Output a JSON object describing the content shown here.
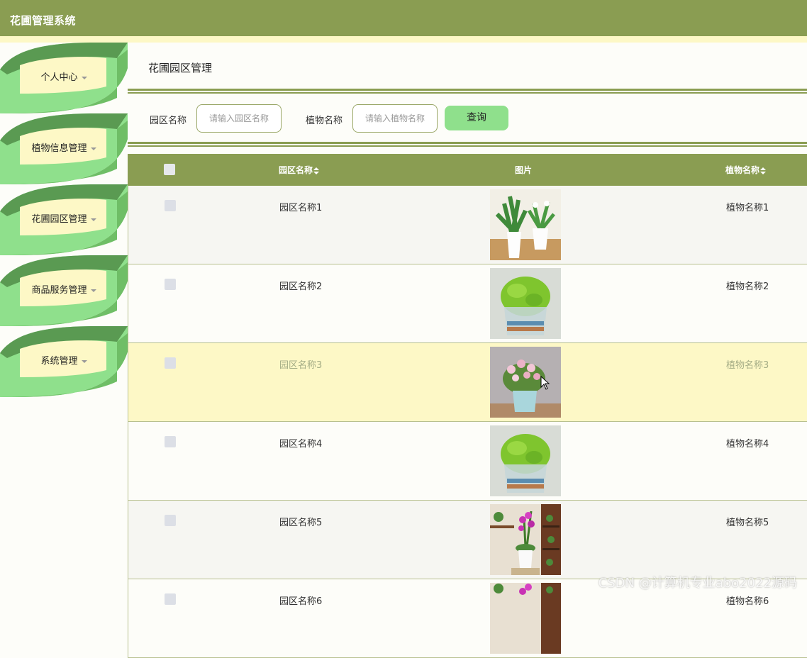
{
  "app": {
    "title": "花圃管理系统"
  },
  "sidebar": {
    "items": [
      {
        "label": "个人中心"
      },
      {
        "label": "植物信息管理"
      },
      {
        "label": "花圃园区管理"
      },
      {
        "label": "商品服务管理"
      },
      {
        "label": "系统管理"
      }
    ]
  },
  "page": {
    "title": "花圃园区管理"
  },
  "search": {
    "zone_label": "园区名称",
    "zone_placeholder": "请输入园区名称",
    "plant_label": "植物名称",
    "plant_placeholder": "请输入植物名称",
    "query_button": "查询"
  },
  "table": {
    "columns": [
      "园区名称",
      "图片",
      "植物名称"
    ],
    "rows": [
      {
        "zone": "园区名称1",
        "plant": "植物名称1",
        "image": "potted-white-flower-plant"
      },
      {
        "zone": "园区名称2",
        "plant": "植物名称2",
        "image": "green-clover-in-glass-pot"
      },
      {
        "zone": "园区名称3",
        "plant": "植物名称3",
        "image": "pink-flowering-plant-in-pot"
      },
      {
        "zone": "园区名称4",
        "plant": "植物名称4",
        "image": "green-clover-in-glass-pot"
      },
      {
        "zone": "园区名称5",
        "plant": "植物名称5",
        "image": "purple-orchid-on-shelf"
      },
      {
        "zone": "园区名称6",
        "plant": "植物名称6",
        "image": "purple-orchid-on-shelf"
      }
    ]
  },
  "colors": {
    "header": "#8a9d52",
    "accent_green": "#8fe08c",
    "dark_green": "#5a9a52",
    "highlight_row": "#fdf8c6"
  },
  "watermark": "CSDN @计算机专业abo2022源码"
}
